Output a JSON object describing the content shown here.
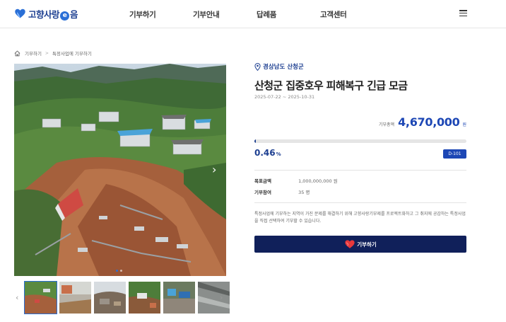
{
  "header": {
    "logo_text_1": "고향사랑",
    "logo_e": "e",
    "logo_text_2": "음",
    "nav": [
      "기부하기",
      "기부안내",
      "답례품",
      "고객센터"
    ]
  },
  "breadcrumb": [
    "기부하기",
    "특정사업에 기부하기"
  ],
  "campaign": {
    "location": "경상남도 산청군",
    "title": "산청군 집중호우 피해복구 긴급 모금",
    "date_range": "2025-07-22 ~ 2025-10-31",
    "amount_label": "기부총액",
    "amount_value": "4,670,000",
    "amount_unit": "원",
    "progress_fraction": 0.0046,
    "percent_value": "0.46",
    "percent_sign": "%",
    "dday": "D-101",
    "goal_label": "목표금액",
    "goal_value": "1,000,000,000 원",
    "participants_label": "기부참여",
    "participants_value": "35 명",
    "description": "특정사업에 기부하는 지역이 가진 문제를 해결하기 위해 고향사랑기부제를 프로젝트화하고 그 취지에 공감하는 특정사업을 직접 선택하여 기부할 수 있습니다.",
    "donate_label": "기부하기"
  },
  "colors": {
    "brand_navy": "#1d3f91",
    "accent_blue": "#1d47b5",
    "button_dark": "#10205a",
    "heart_red": "#e8383b"
  },
  "icons": [
    "heart-logo-icon",
    "home-icon",
    "map-pin-icon",
    "menu-icon",
    "chevron-left-icon",
    "chevron-right-icon",
    "heart-icon"
  ],
  "slider": {
    "slide_count": 6,
    "active_index": 0
  }
}
